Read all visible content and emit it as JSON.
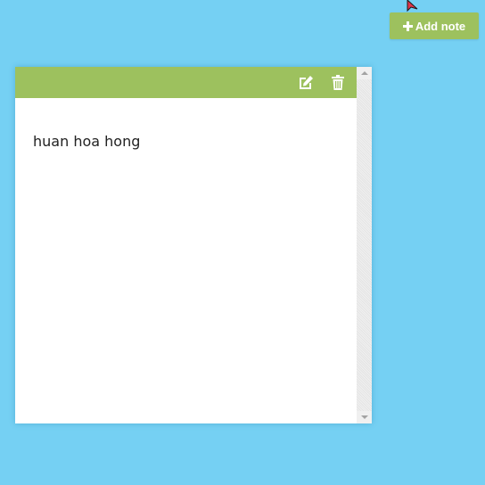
{
  "toolbar": {
    "add_note_label": "Add note"
  },
  "note": {
    "text": "huan hoa hong",
    "edit_icon": "edit-icon",
    "delete_icon": "trash-icon"
  },
  "colors": {
    "background": "#75d0f3",
    "accent": "#9dc15e",
    "note_body": "#ffffff"
  }
}
